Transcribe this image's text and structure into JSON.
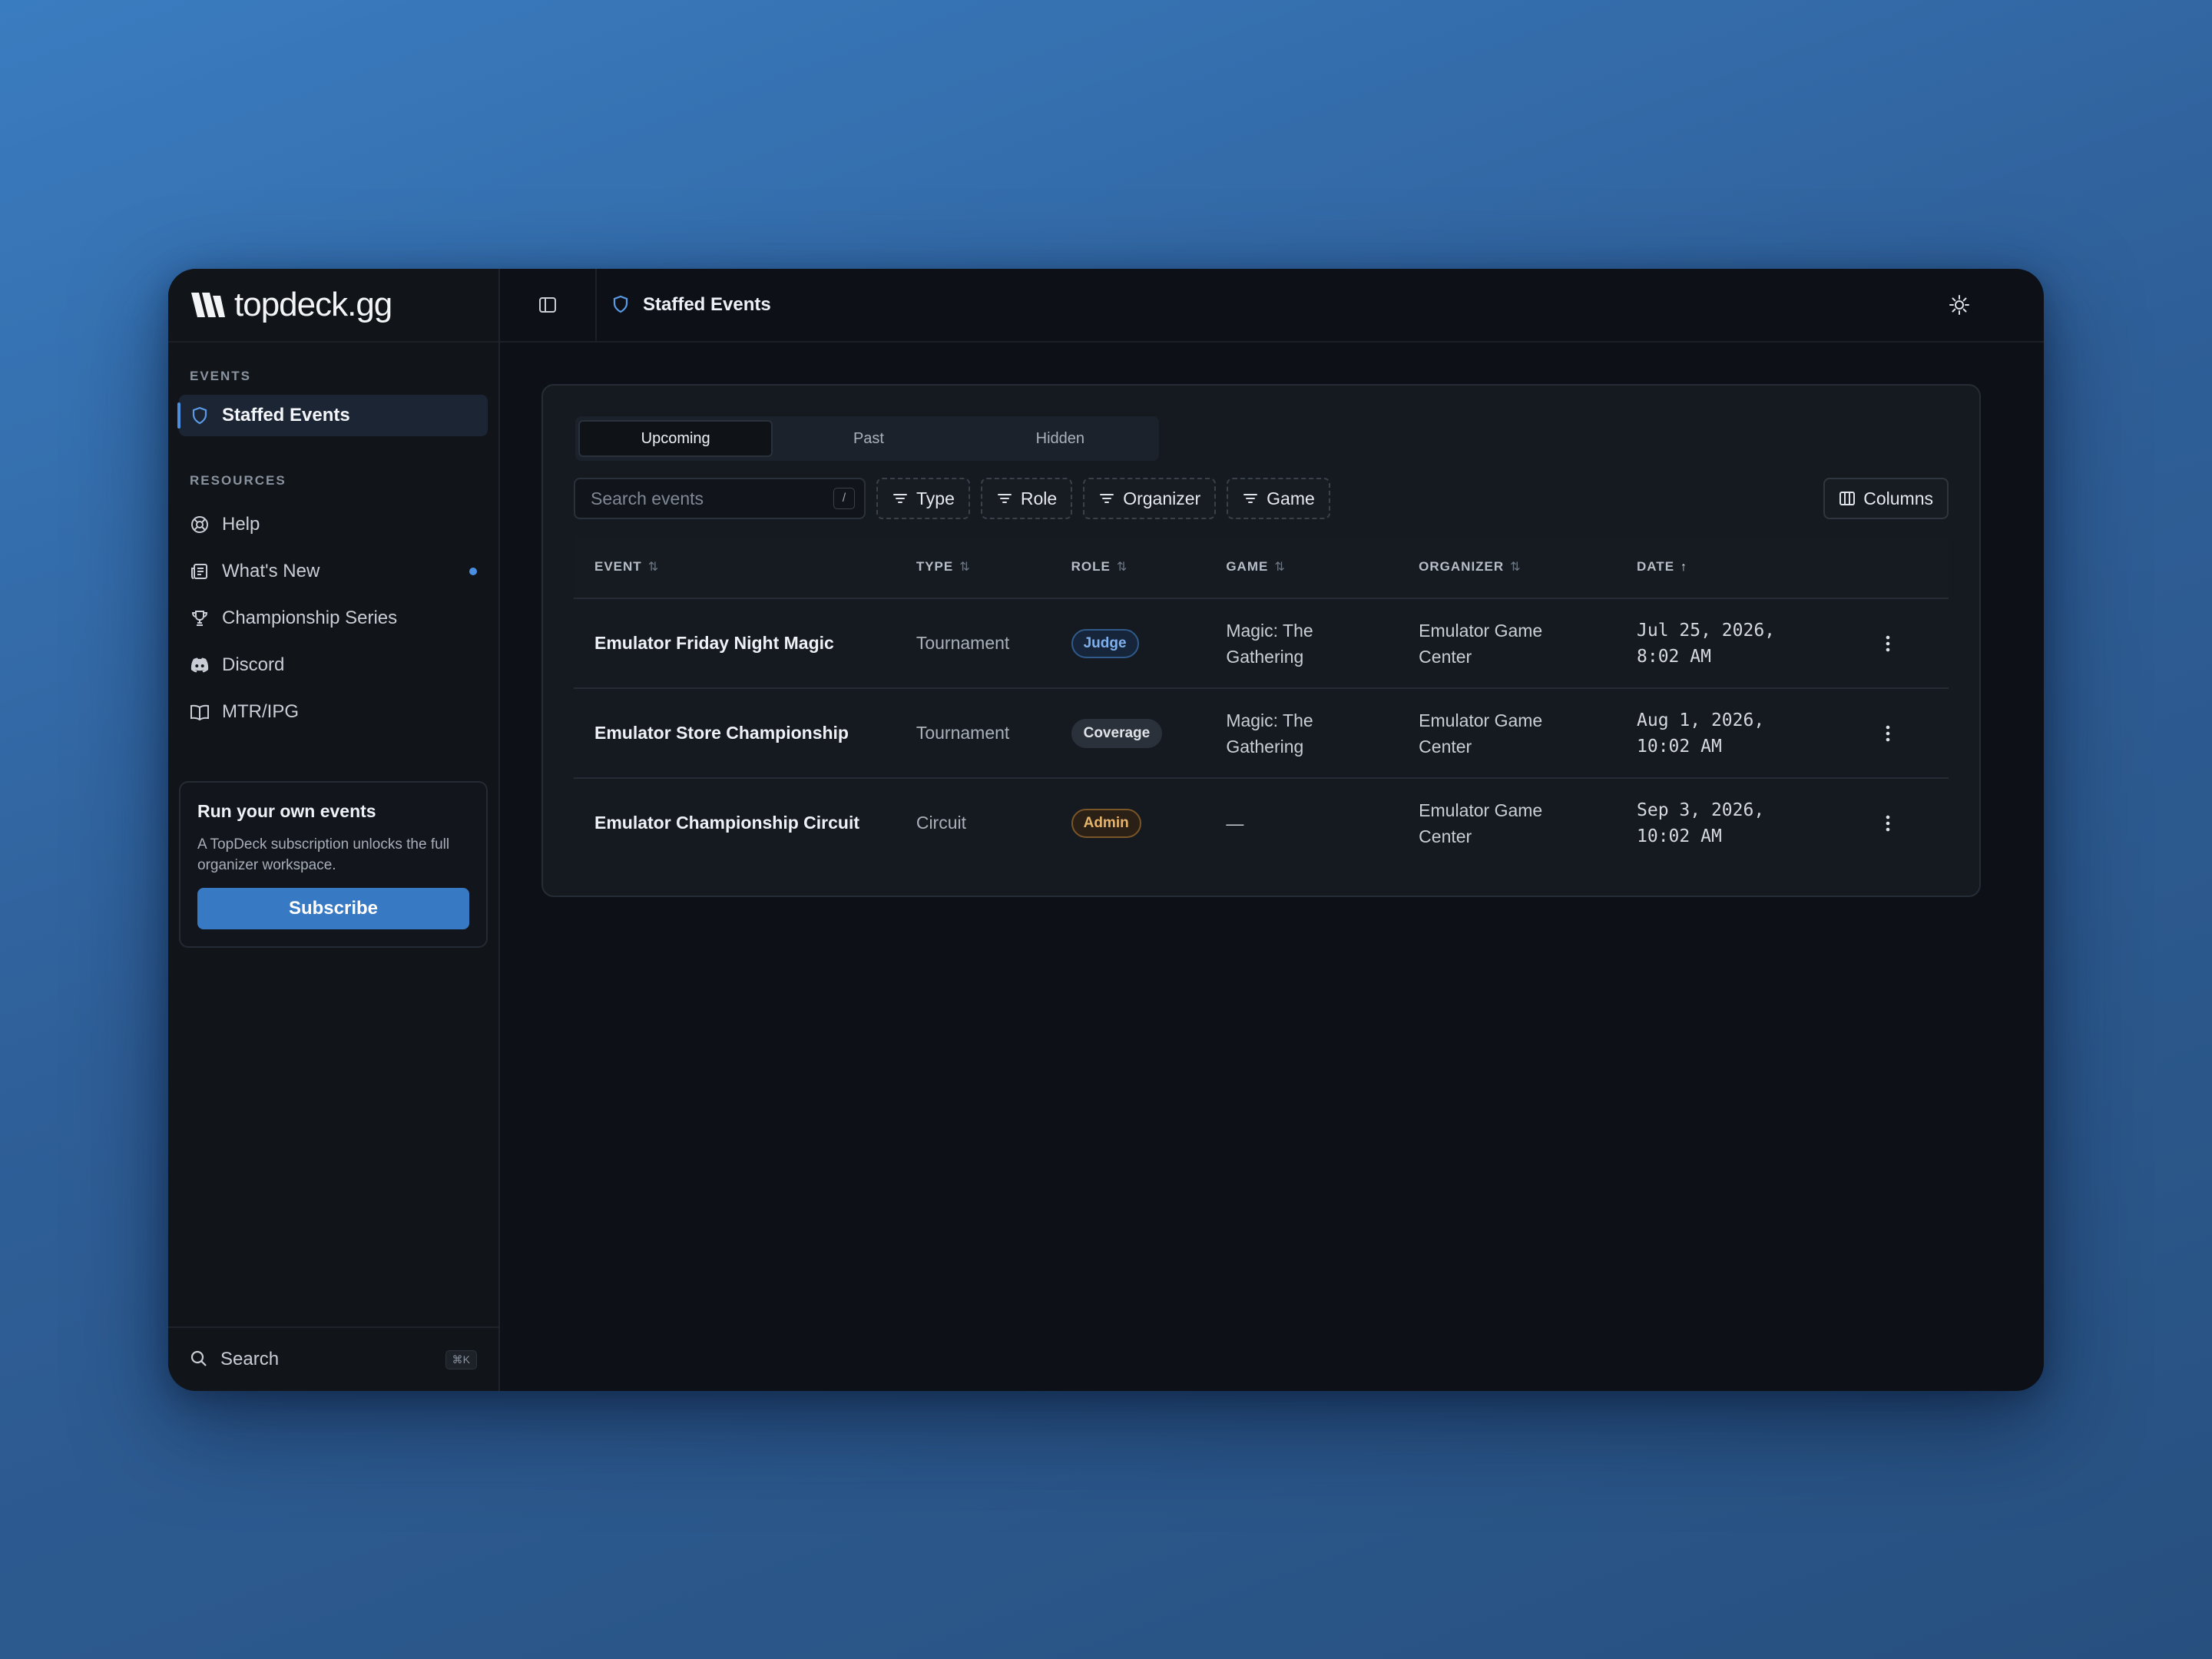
{
  "brand": {
    "name": "topdeck.gg"
  },
  "sidebar": {
    "events_title": "EVENTS",
    "active_item": "Staffed Events",
    "resources_title": "RESOURCES",
    "resources": [
      {
        "label": "Help",
        "icon": "lifebuoy-icon"
      },
      {
        "label": "What's New",
        "icon": "newspaper-icon",
        "has_dot": true
      },
      {
        "label": "Championship Series",
        "icon": "trophy-icon"
      },
      {
        "label": "Discord",
        "icon": "discord-icon"
      },
      {
        "label": "MTR/IPG",
        "icon": "book-icon"
      }
    ],
    "promo": {
      "title": "Run your own events",
      "text": "A TopDeck subscription unlocks the full organizer workspace.",
      "button": "Subscribe"
    },
    "search": {
      "label": "Search",
      "shortcut": "⌘K"
    }
  },
  "header": {
    "title": "Staffed Events"
  },
  "tabs": [
    "Upcoming",
    "Past",
    "Hidden"
  ],
  "active_tab": "Upcoming",
  "toolbar": {
    "search_placeholder": "Search events",
    "search_shortcut": "/",
    "filters": [
      "Type",
      "Role",
      "Organizer",
      "Game"
    ],
    "columns_label": "Columns"
  },
  "table": {
    "headers": [
      "EVENT",
      "TYPE",
      "ROLE",
      "GAME",
      "ORGANIZER",
      "DATE"
    ],
    "rows": [
      {
        "event": "Emulator Friday Night Magic",
        "type": "Tournament",
        "role": "Judge",
        "game_line1": "Magic: The",
        "game_line2": "Gathering",
        "org_line1": "Emulator Game",
        "org_line2": "Center",
        "date_line1": "Jul 25, 2026,",
        "date_line2": "8:02 AM"
      },
      {
        "event": "Emulator Store Championship",
        "type": "Tournament",
        "role": "Coverage",
        "game_line1": "Magic: The",
        "game_line2": "Gathering",
        "org_line1": "Emulator Game",
        "org_line2": "Center",
        "date_line1": "Aug 1, 2026,",
        "date_line2": "10:02 AM"
      },
      {
        "event": "Emulator Championship Circuit",
        "type": "Circuit",
        "role": "Admin",
        "game_line1": "—",
        "game_line2": "",
        "org_line1": "Emulator Game",
        "org_line2": "Center",
        "date_line1": "Sep 3, 2026,",
        "date_line2": "10:02 AM"
      }
    ]
  },
  "colors": {
    "accent": "#3779c3",
    "judge": "#7fb0ee",
    "admin": "#e7b36a"
  }
}
